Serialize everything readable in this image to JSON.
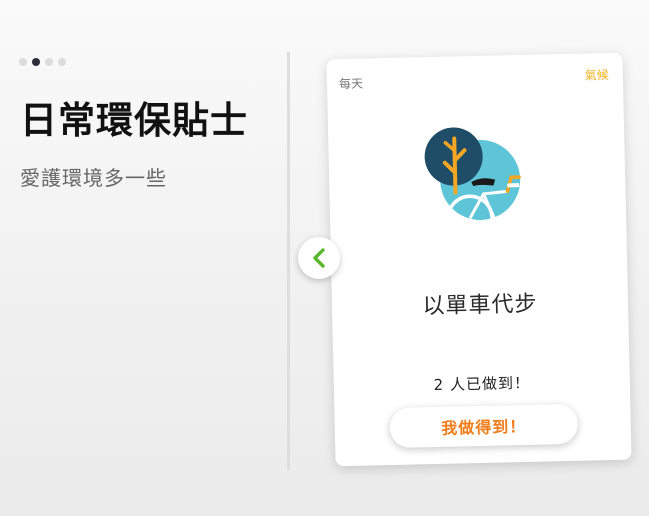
{
  "pager": {
    "total": 4,
    "current": 2
  },
  "header": {
    "title": "日常環保貼士",
    "subtitle": "愛護環境多一些"
  },
  "card": {
    "frequency": "每天",
    "category": "氣候",
    "action": "以單車代步",
    "count_text": "2 人已做到！",
    "button_label": "我做得到！",
    "illustration_icon": "bicycle-tree-icon"
  },
  "nav": {
    "prev_icon": "chevron-left-icon"
  },
  "colors": {
    "category": "#f2b01e",
    "button_text": "#ef7d1a",
    "chevron": "#5bb82e",
    "dot_active": "#2c2c3a",
    "dot_inactive": "#dcdcdc"
  }
}
